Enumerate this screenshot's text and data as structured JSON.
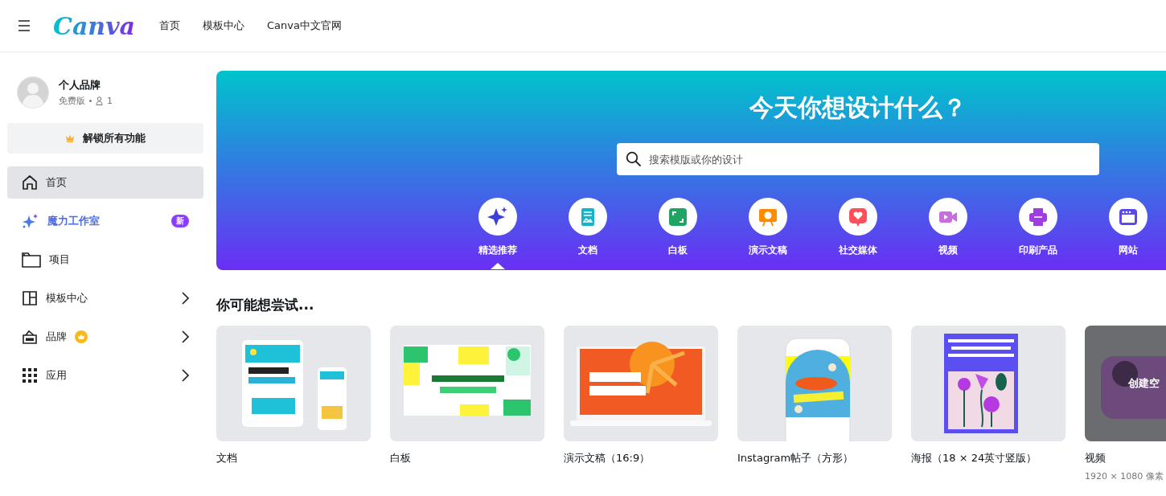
{
  "header": {
    "logo": "Canva",
    "nav": [
      "首页",
      "模板中心",
      "Canva中文官网"
    ]
  },
  "account": {
    "name": "个人品牌",
    "plan": "免费版",
    "members": "1"
  },
  "upgrade_button": "解锁所有功能",
  "sidebar": {
    "items": [
      {
        "label": "首页",
        "kind": "home",
        "selected": true
      },
      {
        "label": "魔力工作室",
        "kind": "magic",
        "selected": false,
        "badge": "新"
      },
      {
        "label": "项目",
        "kind": "folder",
        "selected": false
      },
      {
        "label": "模板中心",
        "kind": "templates",
        "selected": false,
        "expandable": true
      },
      {
        "label": "品牌",
        "kind": "brand",
        "selected": false,
        "expandable": true,
        "premium": true
      },
      {
        "label": "应用",
        "kind": "apps",
        "selected": false,
        "expandable": true
      }
    ]
  },
  "hero": {
    "title": "今天你想设计什么？",
    "search": {
      "placeholder": "搜索模版或你的设计"
    },
    "categories": [
      {
        "label": "精选推荐",
        "kind": "sparkle",
        "color": "#3d3fd8",
        "selected": true
      },
      {
        "label": "文档",
        "kind": "doc",
        "color": "#13b5c8",
        "selected": false
      },
      {
        "label": "白板",
        "kind": "board",
        "color": "#1fa463",
        "selected": false
      },
      {
        "label": "演示文稿",
        "kind": "present",
        "color": "#ff8a00",
        "selected": false
      },
      {
        "label": "社交媒体",
        "kind": "social",
        "color": "#ff4f5a",
        "selected": false
      },
      {
        "label": "视频",
        "kind": "video",
        "color": "#c86ce0",
        "selected": false
      },
      {
        "label": "印刷产品",
        "kind": "print",
        "color": "#a03de0",
        "selected": false
      },
      {
        "label": "网站",
        "kind": "web",
        "color": "#5b49e8",
        "selected": false
      }
    ]
  },
  "suggestions": {
    "title": "你可能想尝试...",
    "cards": [
      {
        "label": "文档",
        "kind": "doc"
      },
      {
        "label": "白板",
        "kind": "board"
      },
      {
        "label": "演示文稿（16:9）",
        "kind": "present"
      },
      {
        "label": "Instagram帖子（方形）",
        "kind": "phone"
      },
      {
        "label": "海报（18 × 24英寸竖版）",
        "kind": "poster"
      },
      {
        "label": "视频",
        "kind": "video",
        "overlay": "创建空",
        "subtitle": "1920 × 1080 像素"
      }
    ]
  }
}
